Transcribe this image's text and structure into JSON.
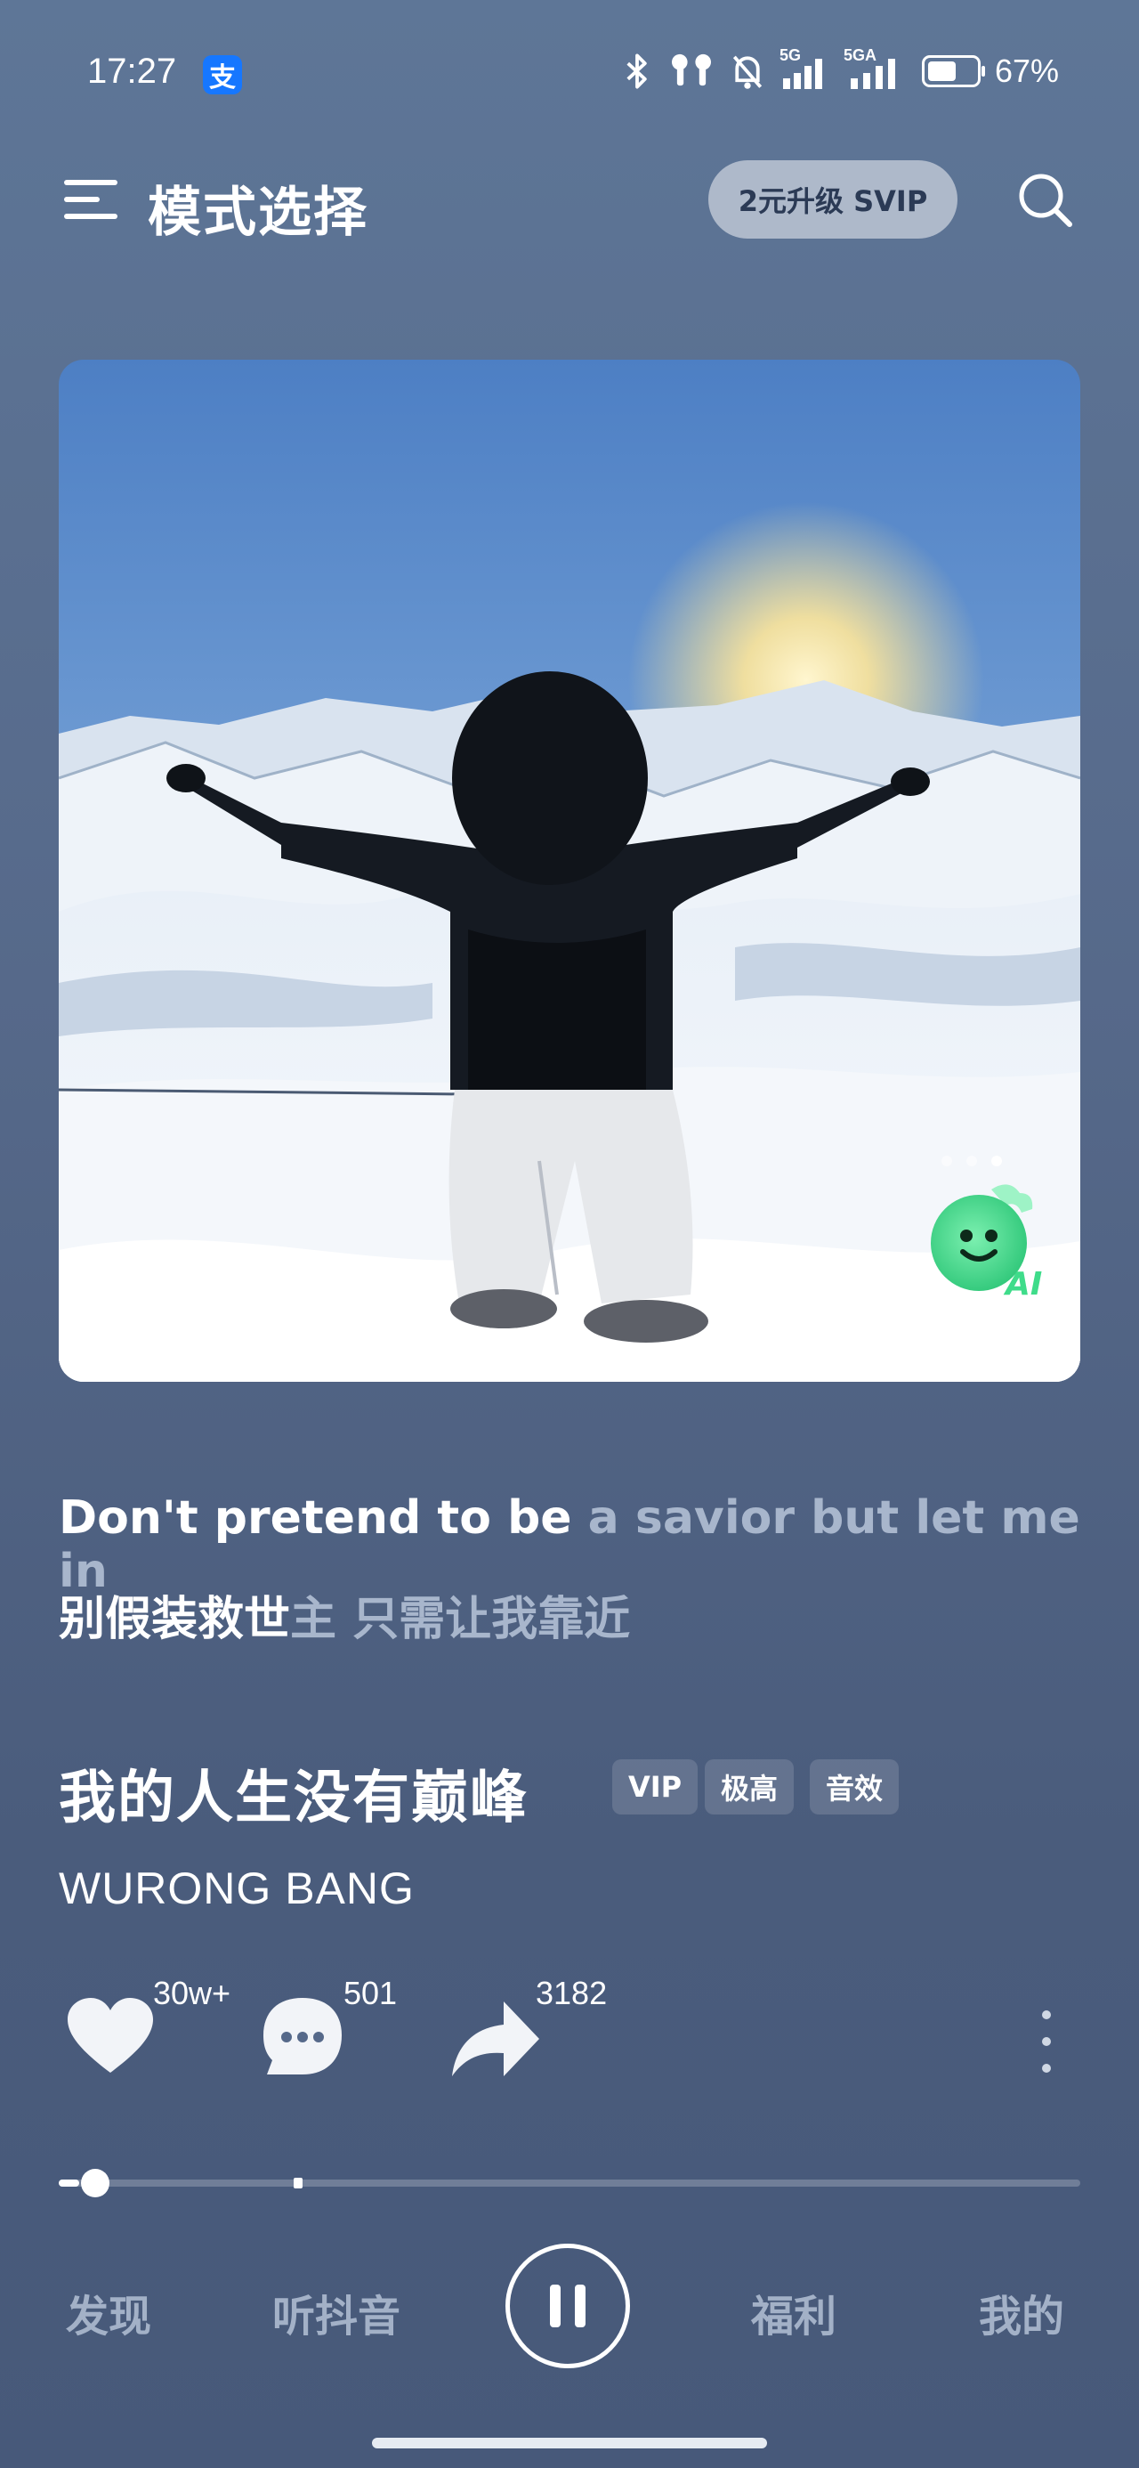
{
  "status_bar": {
    "time": "17:27",
    "alipay_badge": "支",
    "network_5g": "5G",
    "network_5ga": "5GA",
    "battery_percent": "67%",
    "battery_level": 0.67
  },
  "header": {
    "title": "模式选择",
    "svip_button": "2元升级 SVIP"
  },
  "cover": {
    "alt": "Person in black jacket with arms outstretched on snowy mountain peak at sunrise",
    "ai_badge_label": "AI"
  },
  "lyrics": {
    "en_sung": "Don't pretend to be",
    "en_unsung": " a savior but let me in",
    "zh_sung": "别假装救世",
    "zh_unsung": "主 只需让我靠近"
  },
  "song": {
    "title": "我的人生没有巅峰",
    "tags": [
      "VIP",
      "极高",
      "音效"
    ],
    "artist": "WURONG BANG"
  },
  "actions": {
    "likes": "30w+",
    "comments": "501",
    "shares": "3182"
  },
  "player": {
    "progress_fraction": 0.02
  },
  "nav": {
    "items": [
      "发现",
      "听抖音",
      "福利",
      "我的"
    ]
  },
  "colors": {
    "background": "#56698a",
    "svip_pill": "#aeb9ca",
    "ai_badge": "#3fdc8a",
    "unsung_lyric": "#a8b6cc"
  }
}
